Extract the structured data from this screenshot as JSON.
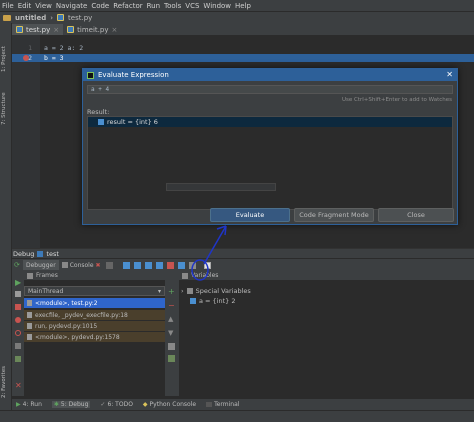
{
  "menu": [
    "File",
    "Edit",
    "View",
    "Navigate",
    "Code",
    "Refactor",
    "Run",
    "Tools",
    "VCS",
    "Window",
    "Help"
  ],
  "breadcrumb": {
    "project": "untitled",
    "file": "test.py"
  },
  "editor_tabs": [
    {
      "label": "test.py",
      "active": true
    },
    {
      "label": "timeit.py",
      "active": false
    }
  ],
  "code_lines": [
    {
      "num": "1",
      "text": "a = 2  a: 2"
    },
    {
      "num": "2",
      "text": "b = 3"
    }
  ],
  "side_tabs": {
    "project": "1: Project",
    "structure": "7: Structure",
    "favorites": "2: Favorites"
  },
  "dialog": {
    "title": "Evaluate Expression",
    "expression": "a + 4",
    "hint": "Use Ctrl+Shift+Enter to add to Watches",
    "result_label": "Result:",
    "result_value": "result = {int} 6",
    "buttons": {
      "evaluate": "Evaluate",
      "fragment": "Code Fragment Mode",
      "close": "Close"
    }
  },
  "debug": {
    "header": "Debug",
    "config": "test",
    "tabs": {
      "debugger": "Debugger",
      "console": "Console"
    },
    "frames_label": "Frames",
    "variables_label": "Variables",
    "thread": "MainThread",
    "frames": [
      {
        "label": "<module>, test.py:2",
        "selected": true
      },
      {
        "label": "execfile, _pydev_execfile.py:18",
        "selected": false
      },
      {
        "label": "run, pydevd.py:1015",
        "selected": false
      },
      {
        "label": "<module>, pydevd.py:1578",
        "selected": false
      }
    ],
    "variables": [
      {
        "label": "Special Variables"
      },
      {
        "label": "a = {int} 2"
      }
    ]
  },
  "bottom_tabs": {
    "run": "4: Run",
    "debug": "5: Debug",
    "todo": "6: TODO",
    "python_console": "Python Console",
    "terminal": "Terminal"
  },
  "colors": {
    "accent": "#2d6099",
    "selection": "#2f65ca",
    "annotation": "#1f35c8",
    "breakpoint": "#c75450"
  }
}
